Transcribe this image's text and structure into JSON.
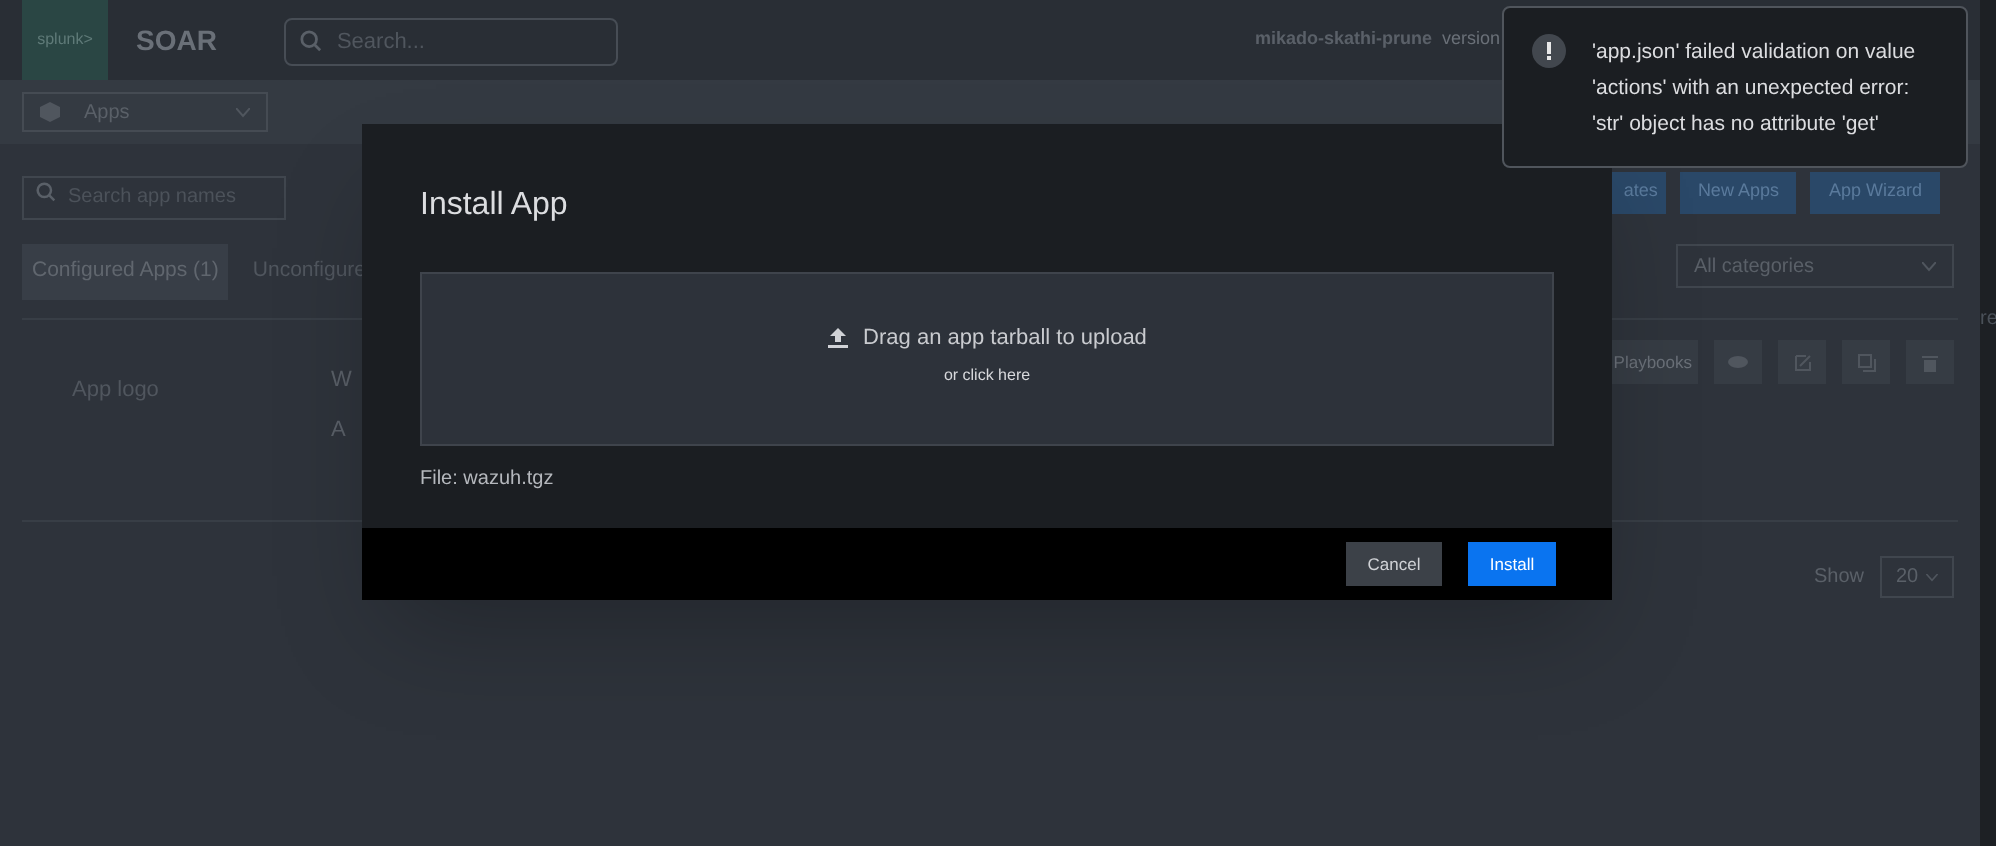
{
  "header": {
    "logo": "splunk>",
    "product": "SOAR",
    "search": {
      "placeholder": "Search..."
    },
    "instance": "mikado-skathi-prune",
    "version": "version"
  },
  "nav": {
    "dropdown": "Apps"
  },
  "apps_page": {
    "search": {
      "placeholder": "Search app names"
    },
    "buttons": [
      {
        "label": "ates"
      },
      {
        "label": "New Apps"
      },
      {
        "label": "App Wizard"
      }
    ],
    "tabs": [
      {
        "label": "Configured Apps (1)",
        "selected": true
      },
      {
        "label": "Unconfigure",
        "selected": false
      }
    ],
    "category_filter": "All categories",
    "row": {
      "logo": "App logo",
      "column_2": [
        "W",
        "A"
      ],
      "playbooks_button": "Playbooks"
    },
    "show_label": "Show",
    "page_size": "20",
    "edge_text": "re"
  },
  "dialog": {
    "title": "Install App",
    "dropzone": {
      "text": "Drag an app tarball to upload",
      "subtext": "or click here"
    },
    "file": "File: wazuh.tgz",
    "buttons": [
      {
        "label": "Cancel",
        "kind": "secondary"
      },
      {
        "label": "Install",
        "kind": "primary"
      }
    ]
  },
  "toast": {
    "message": "'app.json' failed validation on value 'actions' with an unexpected error: 'str' object has no attribute 'get'"
  }
}
